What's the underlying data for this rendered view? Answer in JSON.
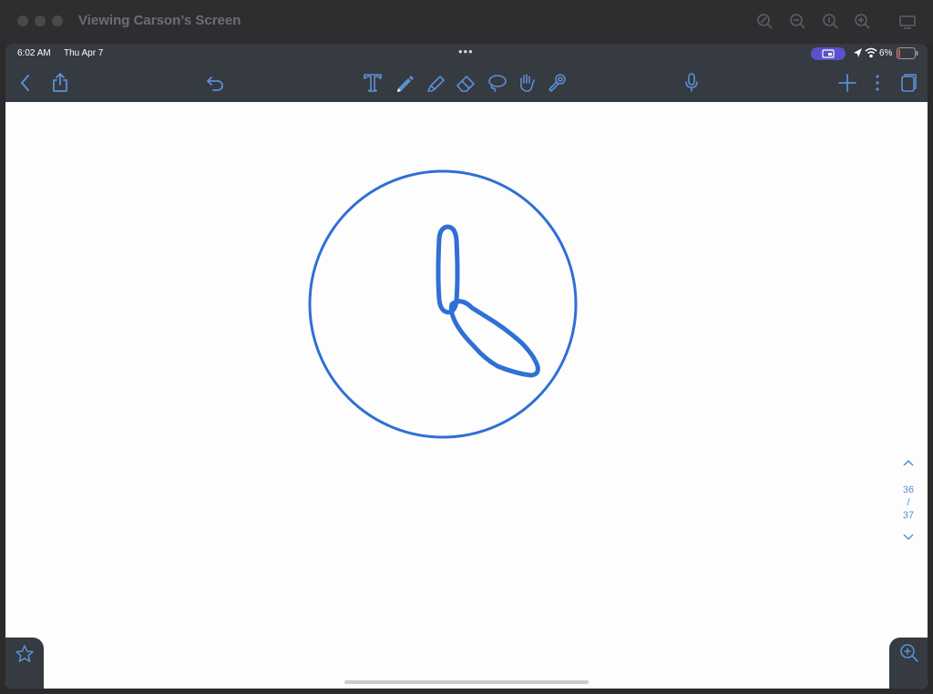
{
  "window": {
    "title": "Viewing Carson’s Screen",
    "toolbar_icons": [
      "zoom-fit-icon",
      "zoom-out-icon",
      "zoom-actual-icon",
      "zoom-in-icon",
      "display-icon"
    ]
  },
  "status_bar": {
    "time": "6:02 AM",
    "date": "Thu Apr 7",
    "battery": "6%"
  },
  "app_toolbar": {
    "left_icons": [
      "back-icon",
      "share-icon",
      "undo-icon"
    ],
    "tools": [
      "text-tool-icon",
      "pen-tool-icon",
      "highlighter-tool-icon",
      "eraser-tool-icon",
      "lasso-tool-icon",
      "hand-tool-icon",
      "laser-pointer-icon"
    ],
    "right_icons": [
      "microphone-icon",
      "add-page-icon",
      "more-icon",
      "pages-icon"
    ]
  },
  "pager": {
    "current": "36",
    "separator": "/",
    "total": "37"
  },
  "colors": {
    "ink": "#2f6fd6",
    "accent": "#5b8fd6",
    "toolbar_bg": "#363a41",
    "canvas_bg": "#fdfdfd"
  }
}
